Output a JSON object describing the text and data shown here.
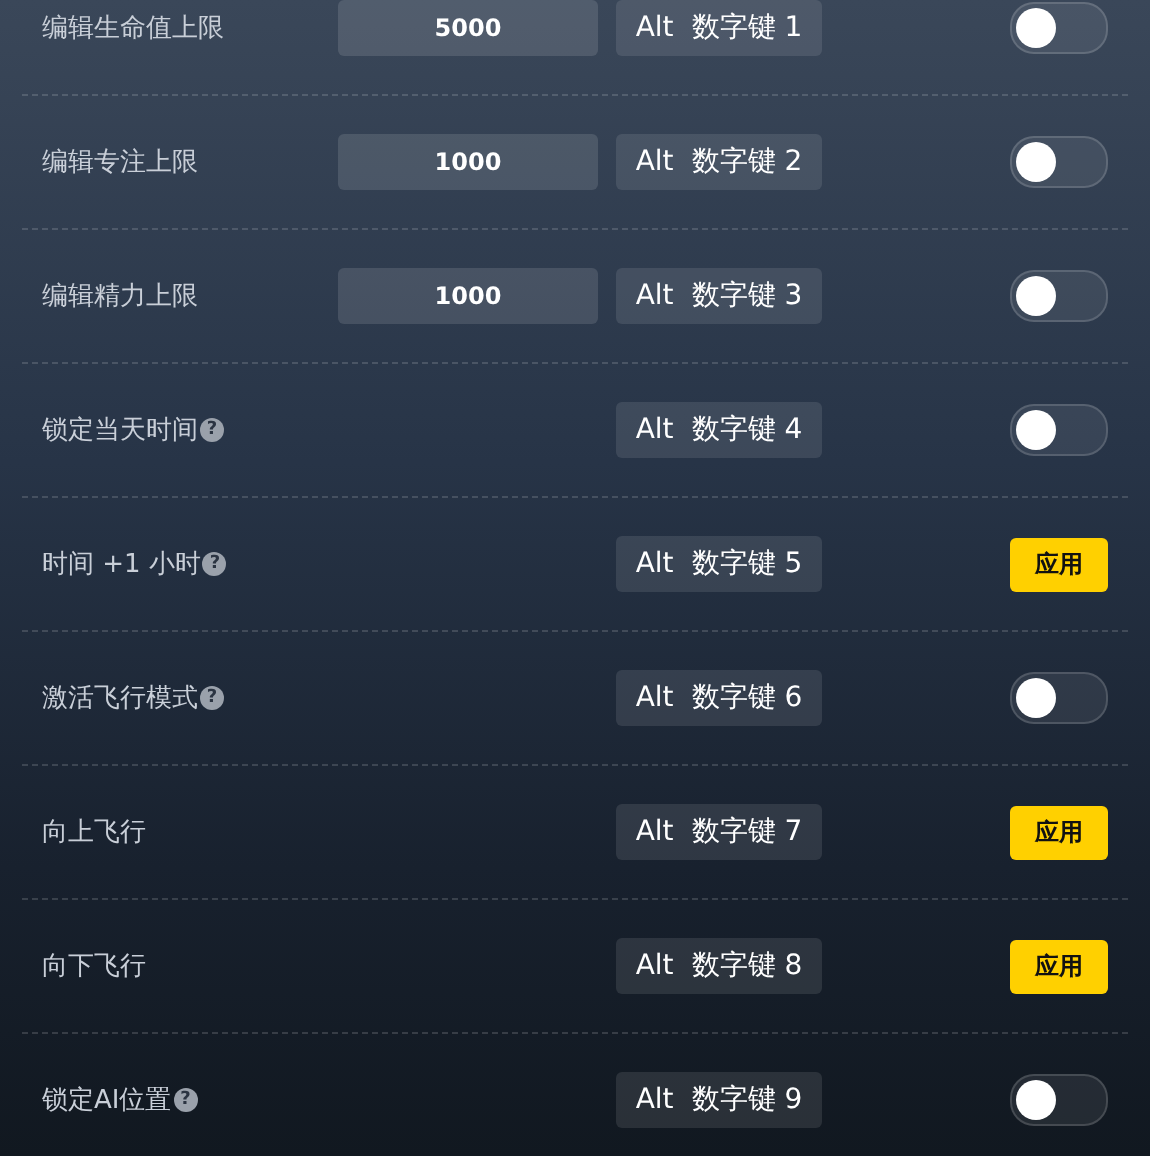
{
  "rows": [
    {
      "label": "编辑生命值上限",
      "value": "5000",
      "hotkey": [
        "Alt",
        "数字键 1"
      ],
      "kind": "toggle",
      "on": false
    },
    {
      "label": "编辑专注上限",
      "value": "1000",
      "hotkey": [
        "Alt",
        "数字键 2"
      ],
      "kind": "toggle",
      "on": false
    },
    {
      "label": "编辑精力上限",
      "value": "1000",
      "hotkey": [
        "Alt",
        "数字键 3"
      ],
      "kind": "toggle",
      "on": false
    },
    {
      "label": "锁定当天时间",
      "help": "?",
      "hotkey": [
        "Alt",
        "数字键 4"
      ],
      "kind": "toggle",
      "on": false
    },
    {
      "label": "时间 +1 小时",
      "help": "?",
      "hotkey": [
        "Alt",
        "数字键 5"
      ],
      "kind": "button",
      "button": "应用"
    },
    {
      "label": "激活飞行模式",
      "help": "?",
      "hotkey": [
        "Alt",
        "数字键 6"
      ],
      "kind": "toggle",
      "on": false
    },
    {
      "label": "向上飞行",
      "hotkey": [
        "Alt",
        "数字键 7"
      ],
      "kind": "button",
      "button": "应用"
    },
    {
      "label": "向下飞行",
      "hotkey": [
        "Alt",
        "数字键 8"
      ],
      "kind": "button",
      "button": "应用"
    },
    {
      "label": "锁定AI位置",
      "help": "?",
      "hotkey": [
        "Alt",
        "数字键 9"
      ],
      "kind": "toggle",
      "on": false
    }
  ]
}
